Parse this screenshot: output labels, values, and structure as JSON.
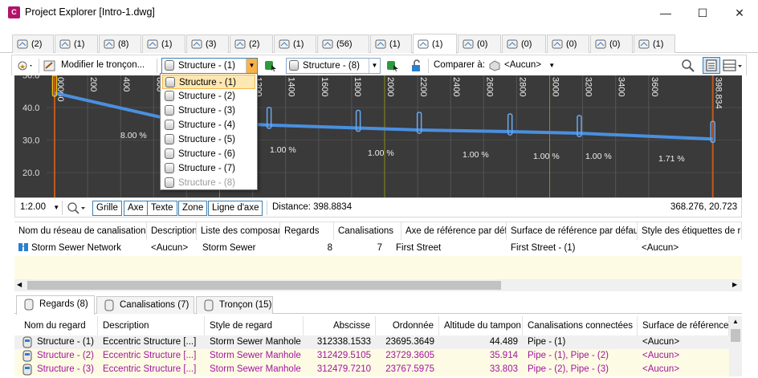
{
  "window": {
    "title": "Project Explorer [Intro-1.dwg]",
    "app_icon_letter": "C",
    "minimize": "—",
    "maximize": "☐",
    "close": "✕"
  },
  "tabs": [
    {
      "count": "(2)",
      "icon": "alignment-icon"
    },
    {
      "count": "(1)",
      "icon": "profile-icon"
    },
    {
      "count": "(8)",
      "icon": "profile-view-icon"
    },
    {
      "count": "(1)",
      "icon": "corridor-icon"
    },
    {
      "count": "(3)",
      "icon": "sample-lines-icon"
    },
    {
      "count": "(2)",
      "icon": "assembly-icon"
    },
    {
      "count": "(1)",
      "icon": "feature-line-icon"
    },
    {
      "count": "(56)",
      "icon": "pipe-icon"
    },
    {
      "count": "(1)",
      "icon": "surface-icon"
    },
    {
      "count": "(1)",
      "icon": "pipe-network-icon",
      "active": true
    },
    {
      "count": "(0)",
      "icon": "pressure-network-icon"
    },
    {
      "count": "(0)",
      "icon": "fitting-icon"
    },
    {
      "count": "(0)",
      "icon": "appurtenance-icon"
    },
    {
      "count": "(0)",
      "icon": "parcel-icon"
    },
    {
      "count": "(1)",
      "icon": "catalog-icon"
    }
  ],
  "toolbar": {
    "modify_label": "Modifier le tronçon...",
    "combo1_value": "Structure - (1)",
    "combo2_value": "Structure - (8)",
    "compare_label": "Comparer à:",
    "compare_value": "<Aucun>"
  },
  "profile": {
    "y_ticks": [
      "50.0",
      "40.0",
      "30.0",
      "20.0"
    ],
    "x_ticks": [
      "0+000",
      "200",
      "400",
      "600",
      "800",
      "1000",
      "1200",
      "1400",
      "1600",
      "1800",
      "2000",
      "2200",
      "2400",
      "2600",
      "2800",
      "3000",
      "3200",
      "3400",
      "3600",
      "398.8834"
    ],
    "x_ticks_visible": [
      "00000",
      "200",
      "400",
      "600",
      "800",
      "1000",
      "1200",
      "1400",
      "1600",
      "1800",
      "2000",
      "2200",
      "2400",
      "2600",
      "2800",
      "3000",
      "3200",
      "3400",
      "3600",
      "398.834"
    ],
    "slopes": [
      "8.00 %",
      "1.00 %",
      "1.00 %",
      "1.00 %",
      "1.00 %",
      "1.00 %",
      "1.71 %"
    ]
  },
  "profile_status": {
    "scale": "1:2.00",
    "buttons": [
      "Grille",
      "Axe",
      "Texte",
      "Zone",
      "Ligne d'axe"
    ],
    "distance": "Distance: 398.8834",
    "coords": "368.276, 20.723"
  },
  "network_grid": {
    "headers": [
      "Nom du réseau de canalisations",
      "Description",
      "Liste des composants",
      "Regards",
      "Canalisations",
      "Axe de référence par défaut",
      "Surface de référence par défaut",
      "Style des étiquettes de rega"
    ],
    "row": [
      "Storm Sewer Network",
      "<Aucun>",
      "Storm Sewer",
      "8",
      "7",
      "First Street",
      "First Street - (1)",
      "<Aucun>"
    ]
  },
  "bottom_tabs": [
    {
      "label": "Regards (8)",
      "icon": "structure-icon",
      "active": true
    },
    {
      "label": "Canalisations (7)",
      "icon": "pipe-icon"
    },
    {
      "label": "Tronçon (15)",
      "icon": "run-icon"
    }
  ],
  "structures_grid": {
    "headers": [
      "Nom du regard",
      "Description",
      "Style de regard",
      "Abscisse",
      "Ordonnée",
      "Altitude du tampon",
      "Canalisations connectées",
      "Surface de référence"
    ],
    "rows": [
      [
        "Structure - (1)",
        "Eccentric Structure  [...]",
        "Storm Sewer Manhole",
        "312338.1533",
        "23695.3649",
        "44.489",
        "Pipe - (1)",
        "<Aucun>"
      ],
      [
        "Structure - (2)",
        "Eccentric Structure  [...]",
        "Storm Sewer Manhole",
        "312429.5105",
        "23729.3605",
        "35.914",
        "Pipe - (1), Pipe - (2)",
        "<Aucun>"
      ],
      [
        "Structure - (3)",
        "Eccentric Structure  [...]",
        "Storm Sewer Manhole",
        "312479.7210",
        "23767.5975",
        "33.803",
        "Pipe - (2), Pipe - (3)",
        "<Aucun>"
      ]
    ]
  },
  "dropdown": {
    "items": [
      "Structure - (1)",
      "Structure - (2)",
      "Structure - (3)",
      "Structure - (4)",
      "Structure - (5)",
      "Structure - (6)",
      "Structure - (7)",
      "Structure - (8)"
    ]
  },
  "colors": {
    "profile_bg": "#3a3a3a",
    "pipe_blue": "#4a8fe0",
    "station_line": "#8a8a18",
    "limit_line": "#c05a20",
    "magenta_text": "#a0169f"
  }
}
